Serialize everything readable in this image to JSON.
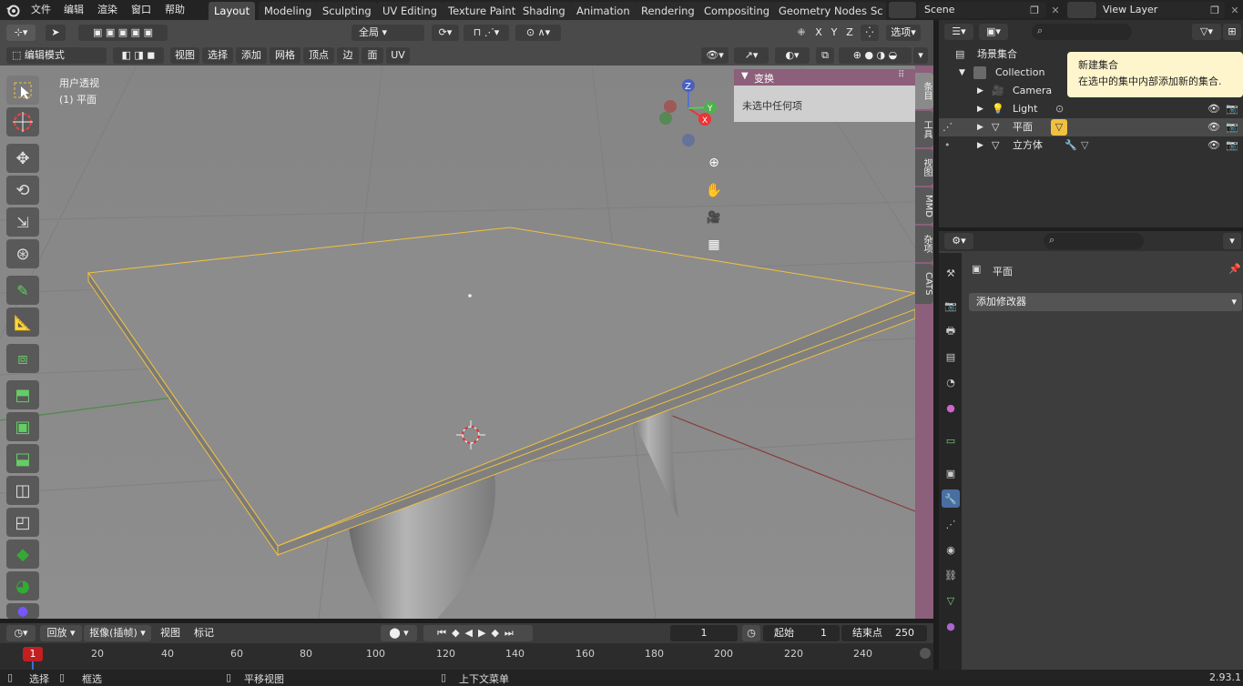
{
  "menu": [
    "文件",
    "编辑",
    "渲染",
    "窗口",
    "帮助"
  ],
  "workspaces": [
    "Layout",
    "Modeling",
    "Sculpting",
    "UV Editing",
    "Texture Paint",
    "Shading",
    "Animation",
    "Rendering",
    "Compositing",
    "Geometry Nodes",
    "Sc"
  ],
  "active_workspace": "Layout",
  "scene": "Scene",
  "view_layer": "View Layer",
  "viewport": {
    "mode": "编辑模式",
    "header_menus": [
      "视图",
      "选择",
      "添加",
      "网格",
      "顶点",
      "边",
      "面",
      "UV"
    ],
    "orientation": "全局",
    "axes": [
      "X",
      "Y",
      "Z"
    ],
    "options": "选项",
    "view_name": "用户透视",
    "object_name": "(1) 平面",
    "gizmo_axes": {
      "x": "X",
      "y": "Y",
      "z": "Z"
    },
    "side_tabs": [
      "条目",
      "工具",
      "视图",
      "MMD",
      "杂项",
      "CATS"
    ]
  },
  "n_panel": {
    "title": "变换",
    "message": "未选中任何项"
  },
  "outliner": {
    "root": "场景集合",
    "collection": "Collection",
    "items": [
      {
        "name": "Camera",
        "icon": "camera-icon"
      },
      {
        "name": "Light",
        "icon": "light-icon"
      },
      {
        "name": "平面",
        "icon": "mesh-icon"
      },
      {
        "name": "立方体",
        "icon": "mesh-icon"
      }
    ],
    "tooltip_title": "新建集合",
    "tooltip_body": "在选中的集中内部添加新的集合."
  },
  "properties": {
    "object_name": "平面",
    "add_modifier": "添加修改器"
  },
  "timeline": {
    "playback": "回放",
    "keying": "抠像(插帧)",
    "view": "视图",
    "marker": "标记",
    "current_frame": "1",
    "start_label": "起始",
    "start": "1",
    "end_label": "结束点",
    "end": "250",
    "ruler_ticks": [
      "1",
      "20",
      "40",
      "60",
      "80",
      "100",
      "120",
      "140",
      "160",
      "180",
      "200",
      "220",
      "240"
    ]
  },
  "status": {
    "select": "选择",
    "box_select": "框选",
    "pan": "平移视图",
    "context_menu": "上下文菜单",
    "version": "2.93.1"
  },
  "colors": {
    "accent_purple": "#8c5f7a",
    "selection_yellow": "#f0c040",
    "active_tab": "#474747",
    "timeline_red": "#c22020"
  }
}
